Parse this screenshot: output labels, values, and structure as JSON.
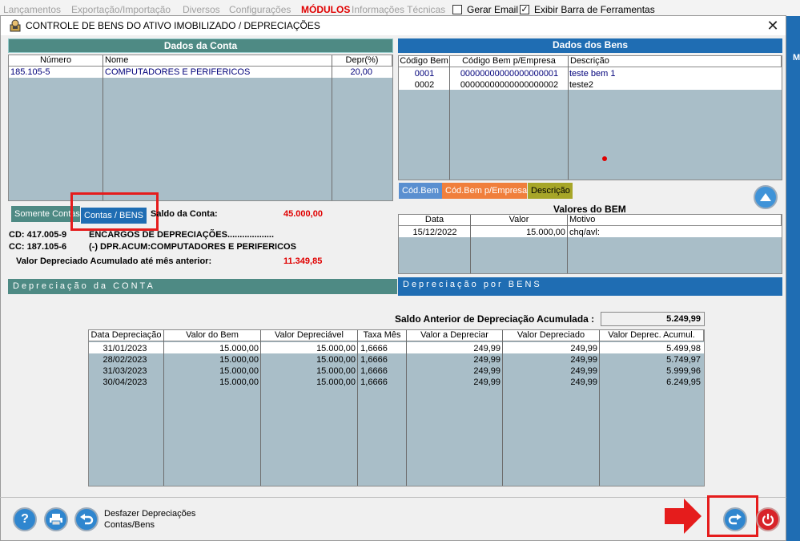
{
  "menu": {
    "items": [
      "Lançamentos",
      "Exportação/Importação",
      "Diversos",
      "Configurações",
      "MÓDULOS",
      "Informações Técnicas"
    ],
    "gerar_email": "Gerar Email",
    "gerar_email_checked": false,
    "exibir_barra": "Exibir Barra de Ferramentas",
    "exibir_barra_checked": true
  },
  "right_strip_letter": "M",
  "window": {
    "title": "CONTROLE DE BENS DO ATIVO IMOBILIZADO / DEPRECIAÇÕES",
    "close": "✕"
  },
  "conta": {
    "header": "Dados da Conta",
    "columns": [
      "Número",
      "Nome",
      "Depr(%)"
    ],
    "rows": [
      {
        "numero": "185.105-5",
        "nome": "COMPUTADORES E PERIFERICOS",
        "depr": "20,00"
      }
    ]
  },
  "bens": {
    "header": "Dados dos Bens",
    "columns": [
      "Código Bem",
      "Código Bem p/Empresa",
      "Descrição"
    ],
    "rows": [
      {
        "codigo": "0001",
        "codigo_empresa": "00000000000000000001",
        "descricao": "teste bem 1"
      },
      {
        "codigo": "0002",
        "codigo_empresa": "00000000000000000002",
        "descricao": "teste2"
      }
    ],
    "sort_tabs": [
      "Cód.Bem",
      "Cód.Bem p/Empresa",
      "Descrição"
    ]
  },
  "tabs": {
    "somente_contas": "Somente Contas",
    "contas_bens": "Contas / BENS"
  },
  "saldo": {
    "label": "Saldo da Conta:",
    "value": "45.000,00"
  },
  "cd": {
    "label": "CD: 417.005-9",
    "desc": "ENCARGOS DE DEPRECIAÇÕES..................."
  },
  "cc": {
    "label": "CC: 187.105-6",
    "desc": "(-) DPR.ACUM:COMPUTADORES E PERIFERICOS"
  },
  "valor_acum": {
    "label": "Valor Depreciado Acumulado até mês anterior:",
    "value": "11.349,85"
  },
  "valores_bem": {
    "title": "Valores do BEM",
    "columns": [
      "Data",
      "Valor",
      "Motivo"
    ],
    "rows": [
      {
        "data": "15/12/2022",
        "valor": "15.000,00",
        "motivo": "chq/avl:"
      }
    ]
  },
  "bottom_tabs": {
    "conta": "Depreciação da CONTA",
    "bens": "Depreciação por BENS"
  },
  "saldo_anterior": {
    "label": "Saldo Anterior de Depreciação Acumulada :",
    "value": "5.249,99"
  },
  "depreciacao": {
    "columns": [
      "Data Depreciação",
      "Valor do Bem",
      "Valor Depreciável",
      "Taxa Mês",
      "Valor a Depreciar",
      "Valor Depreciado",
      "Valor Deprec. Acumul."
    ],
    "rows": [
      [
        "31/01/2023",
        "15.000,00",
        "15.000,00",
        "1,6666",
        "249,99",
        "249,99",
        "5.499,98"
      ],
      [
        "28/02/2023",
        "15.000,00",
        "15.000,00",
        "1,6666",
        "249,99",
        "249,99",
        "5.749,97"
      ],
      [
        "31/03/2023",
        "15.000,00",
        "15.000,00",
        "1,6666",
        "249,99",
        "249,99",
        "5.999,96"
      ],
      [
        "30/04/2023",
        "15.000,00",
        "15.000,00",
        "1,6666",
        "249,99",
        "249,99",
        "6.249,95"
      ]
    ]
  },
  "footer": {
    "line1": "Desfazer Depreciações",
    "line2": "Contas/Bens"
  },
  "colors": {
    "teal": "#4e8a84",
    "blue": "#1f6db3",
    "grid_bg": "#a9bec8",
    "red": "#e00000",
    "orange": "#f07f3c",
    "olive": "#a7a628"
  }
}
